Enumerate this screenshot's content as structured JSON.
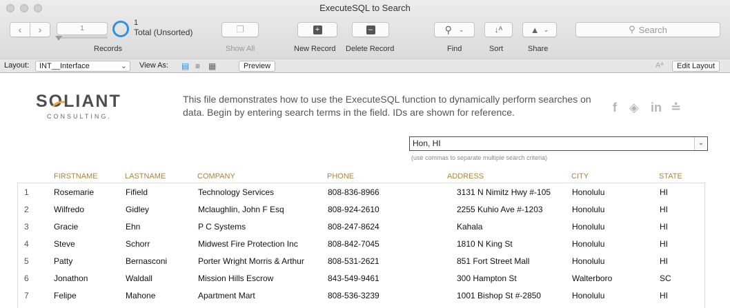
{
  "window": {
    "title": "ExecuteSQL to Search"
  },
  "toolbar": {
    "record_number": "1",
    "found_count": "1",
    "total_label": "Total (Unsorted)",
    "records_label": "Records",
    "show_all_label": "Show All",
    "new_record_label": "New Record",
    "delete_record_label": "Delete Record",
    "find_label": "Find",
    "sort_label": "Sort",
    "share_label": "Share",
    "search_placeholder": "Search"
  },
  "layout_bar": {
    "layout_label": "Layout:",
    "layout_value": "INT__Interface",
    "view_as_label": "View As:",
    "preview_label": "Preview",
    "edit_layout_label": "Edit Layout",
    "text_format_glyph": "Aª"
  },
  "logo": {
    "word": "SOLIANT",
    "sub": "CONSULTING."
  },
  "intro_text": "This file demonstrates how to use the ExecuteSQL function to dynamically perform searches on data. Begin by entering search terms in the field. IDs are shown for reference.",
  "search": {
    "value": "Hon, HI",
    "hint": "(use commas to separate multiple search criteria)"
  },
  "table": {
    "headers": [
      "FIRSTNAME",
      "LASTNAME",
      "COMPANY",
      "PHONE",
      "ADDRESS",
      "CITY",
      "STATE"
    ],
    "rows": [
      {
        "id": "1",
        "first": "Rosemarie",
        "last": "Fifield",
        "company": "Technology Services",
        "phone": "808-836-8966",
        "address": "3131 N Nimitz Hwy  #-105",
        "city": "Honolulu",
        "state": "HI"
      },
      {
        "id": "2",
        "first": "Wilfredo",
        "last": "Gidley",
        "company": "Mclaughlin, John F Esq",
        "phone": "808-924-2610",
        "address": "2255 Kuhio Ave  #-1203",
        "city": "Honolulu",
        "state": "HI"
      },
      {
        "id": "3",
        "first": "Gracie",
        "last": "Ehn",
        "company": "P C Systems",
        "phone": "808-247-8624",
        "address": "Kahala",
        "city": "Honolulu",
        "state": "HI"
      },
      {
        "id": "4",
        "first": "Steve",
        "last": "Schorr",
        "company": "Midwest Fire Protection Inc",
        "phone": "808-842-7045",
        "address": "1810 N King St",
        "city": "Honolulu",
        "state": "HI"
      },
      {
        "id": "5",
        "first": "Patty",
        "last": "Bernasconi",
        "company": "Porter Wright Morris & Arthur",
        "phone": "808-531-2621",
        "address": "851 Fort Street Mall",
        "city": "Honolulu",
        "state": "HI"
      },
      {
        "id": "6",
        "first": "Jonathon",
        "last": "Waldall",
        "company": "Mission Hills Escrow",
        "phone": "843-549-9461",
        "address": "300 Hampton St",
        "city": "Walterboro",
        "state": "SC"
      },
      {
        "id": "7",
        "first": "Felipe",
        "last": "Mahone",
        "company": "Apartment Mart",
        "phone": "808-536-3239",
        "address": "1001 Bishop St  #-2850",
        "city": "Honolulu",
        "state": "HI"
      }
    ]
  },
  "colors": {
    "accent": "#2f8fe0",
    "header_gold": "#a7853f",
    "logo_orange": "#e7a733"
  }
}
